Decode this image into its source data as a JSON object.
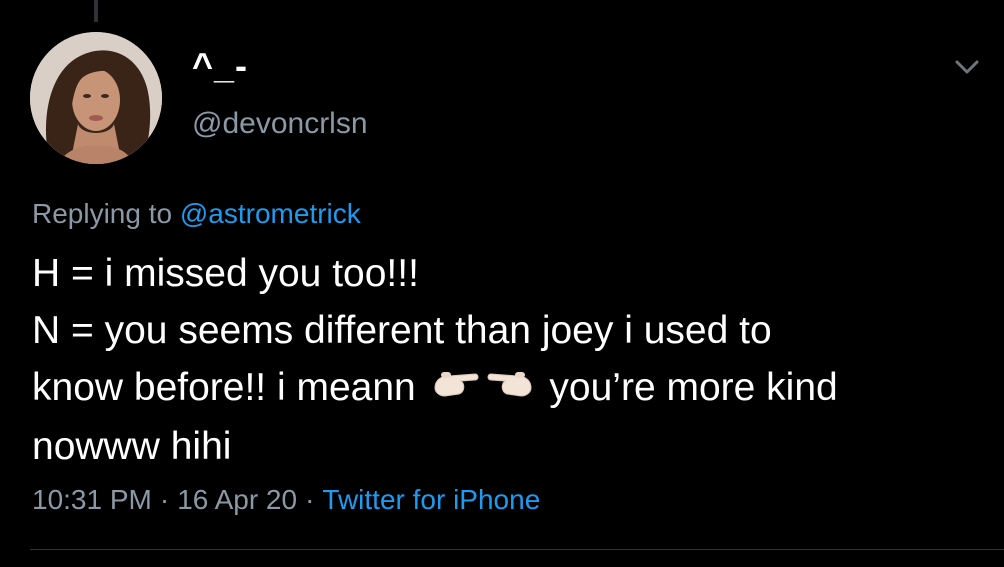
{
  "tweet": {
    "author": {
      "display_name": "^_-",
      "handle": "@devoncrlsn"
    },
    "replying_to": {
      "prefix": "Replying to",
      "mention": "@astrometrick"
    },
    "text_lines": [
      "H = i missed you too!!!",
      "N = you seems different than joey i used to",
      "know before!! i meann",
      "you’re more kind",
      "nowww hihi"
    ],
    "emoji": "pointing-fingers-together",
    "time": "10:31 PM",
    "separator": "·",
    "date": "16 Apr 20",
    "source": "Twitter for iPhone"
  },
  "colors": {
    "background": "#000000",
    "text": "#ffffff",
    "secondary": "#8b98a5",
    "accent": "#1d9bf0"
  },
  "icons": {
    "menu": "chevron-down-icon"
  }
}
